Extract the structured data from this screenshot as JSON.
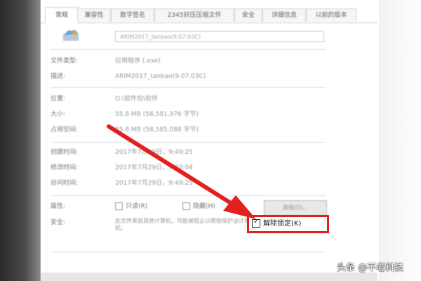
{
  "tabs": [
    {
      "label": "常规",
      "active": true
    },
    {
      "label": "兼容性",
      "active": false
    },
    {
      "label": "数字签名",
      "active": false
    },
    {
      "label": "2345好压压缩文件",
      "active": false
    },
    {
      "label": "安全",
      "active": false
    },
    {
      "label": "详细信息",
      "active": false
    },
    {
      "label": "以前的版本",
      "active": false
    }
  ],
  "file_name": "ARIM2017_tanbao(9.07.03C)",
  "rows": [
    {
      "label": "文件类型:",
      "value": "应用程序 (.exe)"
    },
    {
      "label": "描述:",
      "value": "ARIM2017_tanbao(9.07.03C)"
    },
    {
      "label": "位置:",
      "value": "D:\\软件包\\软件"
    },
    {
      "label": "大小:",
      "value": "55.8 MB (58,581,976 字节)"
    },
    {
      "label": "占用空间:",
      "value": "55.8 MB (58,585,088 字节)"
    },
    {
      "label": "创建时间:",
      "value": "2017年7月29日，9:49:25"
    },
    {
      "label": "修改时间:",
      "value": "2017年7月29日，9:50:04"
    },
    {
      "label": "访问时间:",
      "value": "2017年7月29日，9:49:25"
    }
  ],
  "attributes": {
    "label": "属性:",
    "readonly": "只读(R)",
    "hidden": "隐藏(H)",
    "advanced": "高级(D)..."
  },
  "security": {
    "label": "安全:",
    "text": "此文件来自其他计算机，可能被阻止以帮助保护该计算机。",
    "unlock_label": "解除锁定(K)",
    "unlock_checked": true
  },
  "watermark": "头条 @不老科技",
  "colors": {
    "highlight": "#e32020"
  }
}
